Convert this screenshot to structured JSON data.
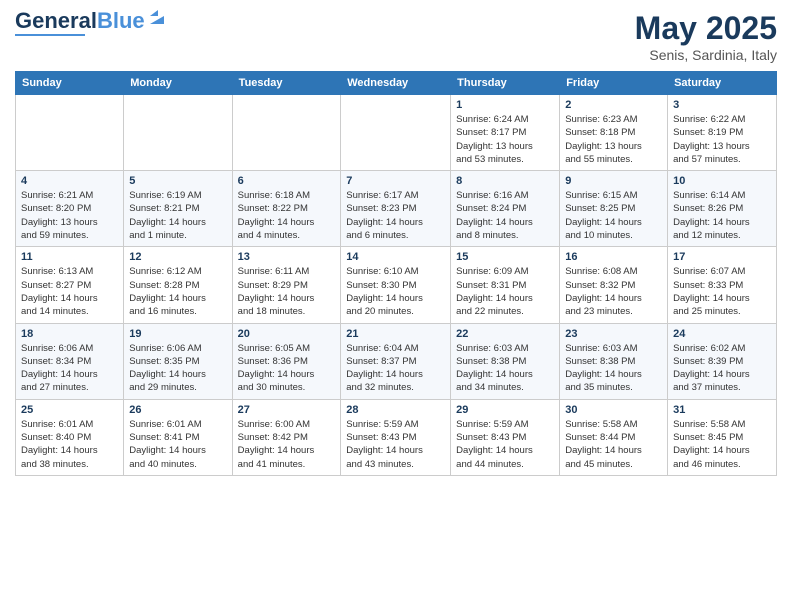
{
  "header": {
    "logo_general": "General",
    "logo_blue": "Blue",
    "month_year": "May 2025",
    "location": "Senis, Sardinia, Italy"
  },
  "days_of_week": [
    "Sunday",
    "Monday",
    "Tuesday",
    "Wednesday",
    "Thursday",
    "Friday",
    "Saturday"
  ],
  "weeks": [
    [
      {
        "day": "",
        "info": ""
      },
      {
        "day": "",
        "info": ""
      },
      {
        "day": "",
        "info": ""
      },
      {
        "day": "",
        "info": ""
      },
      {
        "day": "1",
        "info": "Sunrise: 6:24 AM\nSunset: 8:17 PM\nDaylight: 13 hours\nand 53 minutes."
      },
      {
        "day": "2",
        "info": "Sunrise: 6:23 AM\nSunset: 8:18 PM\nDaylight: 13 hours\nand 55 minutes."
      },
      {
        "day": "3",
        "info": "Sunrise: 6:22 AM\nSunset: 8:19 PM\nDaylight: 13 hours\nand 57 minutes."
      }
    ],
    [
      {
        "day": "4",
        "info": "Sunrise: 6:21 AM\nSunset: 8:20 PM\nDaylight: 13 hours\nand 59 minutes."
      },
      {
        "day": "5",
        "info": "Sunrise: 6:19 AM\nSunset: 8:21 PM\nDaylight: 14 hours\nand 1 minute."
      },
      {
        "day": "6",
        "info": "Sunrise: 6:18 AM\nSunset: 8:22 PM\nDaylight: 14 hours\nand 4 minutes."
      },
      {
        "day": "7",
        "info": "Sunrise: 6:17 AM\nSunset: 8:23 PM\nDaylight: 14 hours\nand 6 minutes."
      },
      {
        "day": "8",
        "info": "Sunrise: 6:16 AM\nSunset: 8:24 PM\nDaylight: 14 hours\nand 8 minutes."
      },
      {
        "day": "9",
        "info": "Sunrise: 6:15 AM\nSunset: 8:25 PM\nDaylight: 14 hours\nand 10 minutes."
      },
      {
        "day": "10",
        "info": "Sunrise: 6:14 AM\nSunset: 8:26 PM\nDaylight: 14 hours\nand 12 minutes."
      }
    ],
    [
      {
        "day": "11",
        "info": "Sunrise: 6:13 AM\nSunset: 8:27 PM\nDaylight: 14 hours\nand 14 minutes."
      },
      {
        "day": "12",
        "info": "Sunrise: 6:12 AM\nSunset: 8:28 PM\nDaylight: 14 hours\nand 16 minutes."
      },
      {
        "day": "13",
        "info": "Sunrise: 6:11 AM\nSunset: 8:29 PM\nDaylight: 14 hours\nand 18 minutes."
      },
      {
        "day": "14",
        "info": "Sunrise: 6:10 AM\nSunset: 8:30 PM\nDaylight: 14 hours\nand 20 minutes."
      },
      {
        "day": "15",
        "info": "Sunrise: 6:09 AM\nSunset: 8:31 PM\nDaylight: 14 hours\nand 22 minutes."
      },
      {
        "day": "16",
        "info": "Sunrise: 6:08 AM\nSunset: 8:32 PM\nDaylight: 14 hours\nand 23 minutes."
      },
      {
        "day": "17",
        "info": "Sunrise: 6:07 AM\nSunset: 8:33 PM\nDaylight: 14 hours\nand 25 minutes."
      }
    ],
    [
      {
        "day": "18",
        "info": "Sunrise: 6:06 AM\nSunset: 8:34 PM\nDaylight: 14 hours\nand 27 minutes."
      },
      {
        "day": "19",
        "info": "Sunrise: 6:06 AM\nSunset: 8:35 PM\nDaylight: 14 hours\nand 29 minutes."
      },
      {
        "day": "20",
        "info": "Sunrise: 6:05 AM\nSunset: 8:36 PM\nDaylight: 14 hours\nand 30 minutes."
      },
      {
        "day": "21",
        "info": "Sunrise: 6:04 AM\nSunset: 8:37 PM\nDaylight: 14 hours\nand 32 minutes."
      },
      {
        "day": "22",
        "info": "Sunrise: 6:03 AM\nSunset: 8:38 PM\nDaylight: 14 hours\nand 34 minutes."
      },
      {
        "day": "23",
        "info": "Sunrise: 6:03 AM\nSunset: 8:38 PM\nDaylight: 14 hours\nand 35 minutes."
      },
      {
        "day": "24",
        "info": "Sunrise: 6:02 AM\nSunset: 8:39 PM\nDaylight: 14 hours\nand 37 minutes."
      }
    ],
    [
      {
        "day": "25",
        "info": "Sunrise: 6:01 AM\nSunset: 8:40 PM\nDaylight: 14 hours\nand 38 minutes."
      },
      {
        "day": "26",
        "info": "Sunrise: 6:01 AM\nSunset: 8:41 PM\nDaylight: 14 hours\nand 40 minutes."
      },
      {
        "day": "27",
        "info": "Sunrise: 6:00 AM\nSunset: 8:42 PM\nDaylight: 14 hours\nand 41 minutes."
      },
      {
        "day": "28",
        "info": "Sunrise: 5:59 AM\nSunset: 8:43 PM\nDaylight: 14 hours\nand 43 minutes."
      },
      {
        "day": "29",
        "info": "Sunrise: 5:59 AM\nSunset: 8:43 PM\nDaylight: 14 hours\nand 44 minutes."
      },
      {
        "day": "30",
        "info": "Sunrise: 5:58 AM\nSunset: 8:44 PM\nDaylight: 14 hours\nand 45 minutes."
      },
      {
        "day": "31",
        "info": "Sunrise: 5:58 AM\nSunset: 8:45 PM\nDaylight: 14 hours\nand 46 minutes."
      }
    ]
  ]
}
